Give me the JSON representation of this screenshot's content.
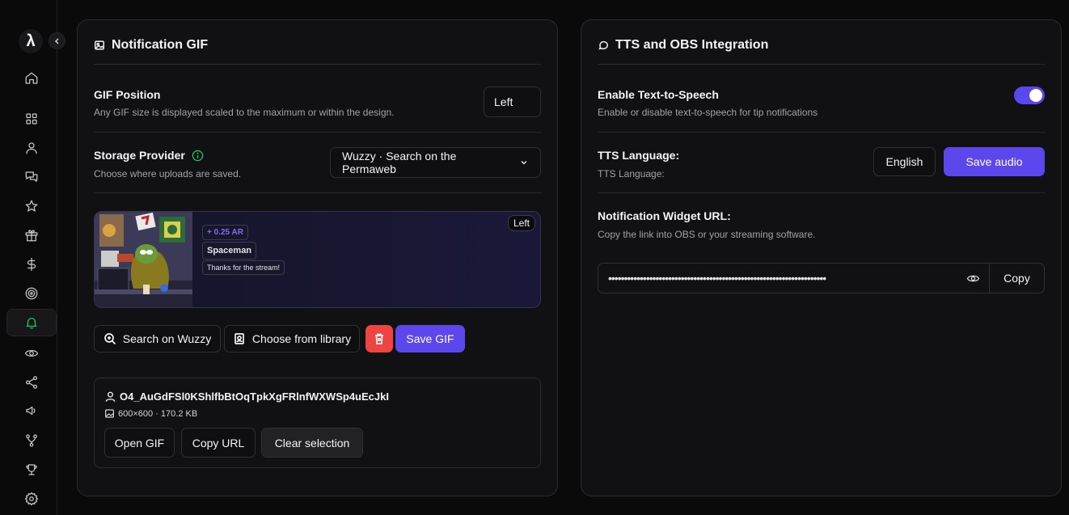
{
  "sidebar": {
    "logo": "λ",
    "items": [
      {
        "icon": "home-icon"
      },
      {
        "icon": "grid-icon"
      },
      {
        "icon": "user-icon"
      },
      {
        "icon": "chat-icon"
      },
      {
        "icon": "star-icon"
      },
      {
        "icon": "gift-icon"
      },
      {
        "icon": "dollar-icon"
      },
      {
        "icon": "target-icon"
      },
      {
        "icon": "bell-icon",
        "active": true
      },
      {
        "icon": "eye-icon"
      },
      {
        "icon": "share-icon"
      },
      {
        "icon": "megaphone-icon"
      },
      {
        "icon": "branch-icon"
      },
      {
        "icon": "trophy-icon"
      },
      {
        "icon": "settings-icon"
      }
    ]
  },
  "notification_gif": {
    "title": "Notification GIF",
    "position_label": "GIF Position",
    "position_desc": "Any GIF size is displayed scaled to the maximum or within the design.",
    "position_value": "Left",
    "storage_label": "Storage Provider",
    "storage_desc": "Choose where uploads are saved.",
    "storage_value": "Wuzzy · Search on the Permaweb",
    "preview": {
      "amount": "+ 0.25 AR",
      "name": "Spaceman",
      "message": "Thanks for the stream!",
      "position_badge": "Left"
    },
    "actions": {
      "search": "Search on Wuzzy",
      "library": "Choose from library",
      "save": "Save GIF"
    },
    "file": {
      "id": "O4_AuGdFSl0KShlfbBtOqTpkXgFRlnfWXWSp4uEcJkI",
      "meta": "600×600 · 170.2 KB",
      "open": "Open GIF",
      "copy": "Copy URL",
      "clear": "Clear selection"
    }
  },
  "tts": {
    "title": "TTS and OBS Integration",
    "enable_label": "Enable Text-to-Speech",
    "enable_desc": "Enable or disable text-to-speech for tip notifications",
    "enabled": true,
    "lang_label": "TTS Language:",
    "lang_desc": "TTS Language:",
    "lang_value": "English",
    "save_audio": "Save audio",
    "widget_label": "Notification Widget URL:",
    "widget_desc": "Copy the link into OBS or your streaming software.",
    "widget_url_masked": "•••••••••••••••••••••••••••••••••••••••••••••••••••••••••••••••••••••",
    "copy": "Copy"
  },
  "colors": {
    "accent": "#5b47ec",
    "active_icon": "#22c55e",
    "danger": "#ef4444"
  }
}
